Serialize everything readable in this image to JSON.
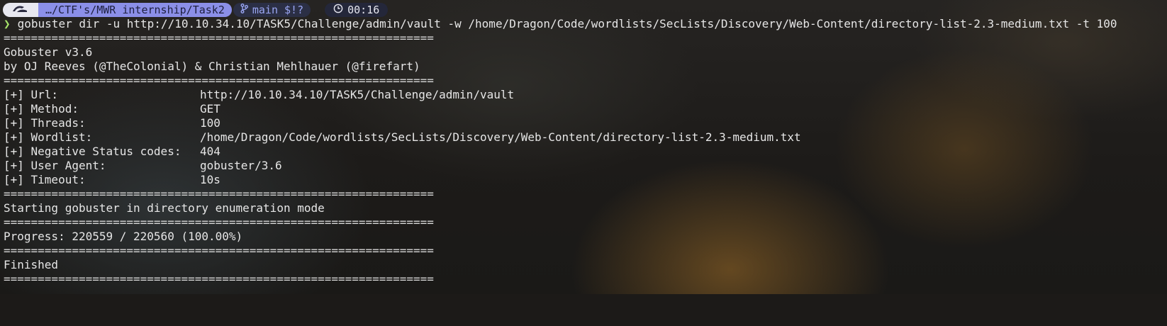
{
  "prompt": {
    "path": "…/CTF's/MWR internship/Task2",
    "git_branch": "main",
    "git_status": "$!?",
    "duration": "00:16",
    "colors": {
      "path_bg": "#8b8fe8",
      "git_fg": "#9aa6f2",
      "chevron": "#a6e36a"
    },
    "icons": [
      "os-logo-icon",
      "git-branch-icon",
      "clock-icon",
      "prompt-chevron-icon"
    ]
  },
  "command": "gobuster dir -u http://10.10.34.10/TASK5/Challenge/admin/vault -w /home/Dragon/Code/wordlists/SecLists/Discovery/Web-Content/directory-list-2.3-medium.txt -t 100",
  "separator": "===============================================================",
  "banner": {
    "version": "Gobuster v3.6",
    "authors": "by OJ Reeves (@TheColonial) & Christian Mehlhauer (@firefart)"
  },
  "config": [
    {
      "key": "[+] Url:",
      "value": "http://10.10.34.10/TASK5/Challenge/admin/vault"
    },
    {
      "key": "[+] Method:",
      "value": "GET"
    },
    {
      "key": "[+] Threads:",
      "value": "100"
    },
    {
      "key": "[+] Wordlist:",
      "value": "/home/Dragon/Code/wordlists/SecLists/Discovery/Web-Content/directory-list-2.3-medium.txt"
    },
    {
      "key": "[+] Negative Status codes:",
      "value": "404"
    },
    {
      "key": "[+] User Agent:",
      "value": "gobuster/3.6"
    },
    {
      "key": "[+] Timeout:",
      "value": "10s"
    }
  ],
  "status": {
    "start": "Starting gobuster in directory enumeration mode",
    "progress": "Progress: 220559 / 220560 (100.00%)",
    "finished": "Finished"
  }
}
